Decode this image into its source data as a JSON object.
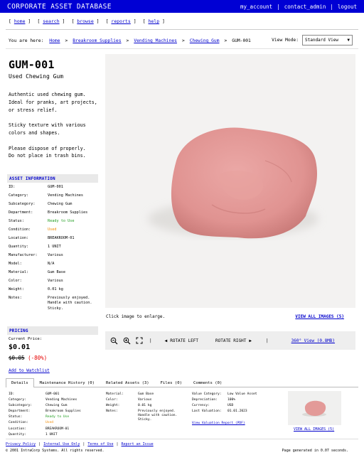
{
  "app": {
    "title": "CORPORATE ASSET DATABASE",
    "top_nav": [
      "my_account",
      "contact_admin",
      "logout"
    ]
  },
  "secondary_nav": [
    "home",
    "search",
    "browse",
    "reports",
    "help"
  ],
  "breadcrumb": {
    "prefix": "You are here:",
    "items": [
      "Home",
      "Breakroom Supplies",
      "Vending Machines",
      "Chewing Gum"
    ],
    "current": "GUM-001"
  },
  "view_mode": {
    "label": "View Mode:",
    "selected": "Standard View"
  },
  "asset": {
    "id": "GUM-001",
    "name": "Used Chewing Gum",
    "description": "Authentic used chewing gum.\nIdeal for pranks, art projects,\nor stress relief.\n\nSticky texture with various\ncolors and shapes.\n\nPlease dispose of properly.\nDo not place in trash bins."
  },
  "asset_info": {
    "heading": "ASSET INFORMATION",
    "rows": [
      {
        "k": "ID:",
        "v": "GUM-001"
      },
      {
        "k": "Category:",
        "v": "Vending Machines"
      },
      {
        "k": "Subcategory:",
        "v": "Chewing Gum"
      },
      {
        "k": "Department:",
        "v": "Breakroom Supplies"
      },
      {
        "k": "Status:",
        "v": "Ready to Use"
      },
      {
        "k": "Condition:",
        "v": "Used"
      },
      {
        "k": "Location:",
        "v": "BREAKROOM-01"
      },
      {
        "k": "Quantity:",
        "v": "1 UNIT"
      },
      {
        "k": "Manufacturer:",
        "v": "Various"
      },
      {
        "k": "Model:",
        "v": "N/A"
      },
      {
        "k": "Material:",
        "v": "Gum Base"
      },
      {
        "k": "Color:",
        "v": "Various"
      },
      {
        "k": "Weight:",
        "v": "0.01 kg"
      },
      {
        "k": "Notes:",
        "v": "Previously enjoyed. Handle with caution. Sticky."
      }
    ]
  },
  "pricing": {
    "heading": "PRICING",
    "current_label": "Current Price:",
    "current_price": "$0.01",
    "old_price": "$0.05",
    "discount": "(-80%)",
    "watchlist": "Add to Watchlist"
  },
  "image": {
    "caption": "Click image to enlarge.",
    "view_all": "VIEW ALL IMAGES (5)"
  },
  "toolbar": {
    "rotate_left": "ROTATE LEFT",
    "rotate_right": "ROTATE RIGHT",
    "view_360": "360° View (0.8MB)"
  },
  "tabs": [
    "Details",
    "Maintenance History (0)",
    "Related Assets (3)",
    "Files (0)",
    "Comments (0)"
  ],
  "details": {
    "col1": [
      {
        "k": "ID:",
        "v": "GUM-001"
      },
      {
        "k": "Category:",
        "v": "Vending Machines"
      },
      {
        "k": "Subcategory:",
        "v": "Chewing Gum"
      },
      {
        "k": "Department:",
        "v": "Breakroom Supplies"
      },
      {
        "k": "Status:",
        "v": "Ready to Use"
      },
      {
        "k": "Condition:",
        "v": "Used"
      },
      {
        "k": "Location:",
        "v": "BREAKROOM-01"
      },
      {
        "k": "Quantity:",
        "v": "1 UNIT"
      }
    ],
    "col2": [
      {
        "k": "Material:",
        "v": "Gum Base"
      },
      {
        "k": "Color:",
        "v": "Various"
      },
      {
        "k": "Weight:",
        "v": "0.01 kg"
      },
      {
        "k": "Notes:",
        "v": "Previously enjoyed. Handle with caution. Sticky."
      }
    ],
    "col3": [
      {
        "k": "Value Category:",
        "v": "Low Value Asset"
      },
      {
        "k": "Depreciation:",
        "v": "100%"
      },
      {
        "k": "Currency:",
        "v": "USD"
      },
      {
        "k": "Last Valuation:",
        "v": "01.01.2023"
      }
    ],
    "valuation_link": "View Valuation Report (PDF)",
    "thumb_link": "VIEW ALL IMAGES (5)"
  },
  "footer": {
    "links": [
      "Privacy Policy",
      "Internal Use Only",
      "Terms of Use",
      "Report an Issue"
    ],
    "copyright": "© 2001 IntraCorp Systems. All rights reserved.",
    "generated": "Page generated in 0.07 seconds."
  },
  "colors": {
    "header_bg": "#0000d4",
    "link": "#0000cc",
    "status_green": "#1e9c1e",
    "condition_orange": "#f08a00",
    "discount_red": "#e60000",
    "gum_pink": "#e39a98"
  },
  "icons": [
    "zoom-out-icon",
    "zoom-in-icon",
    "fullscreen-icon",
    "rotate-left-arrow-icon",
    "rotate-right-arrow-icon",
    "select-arrow-icon"
  ]
}
